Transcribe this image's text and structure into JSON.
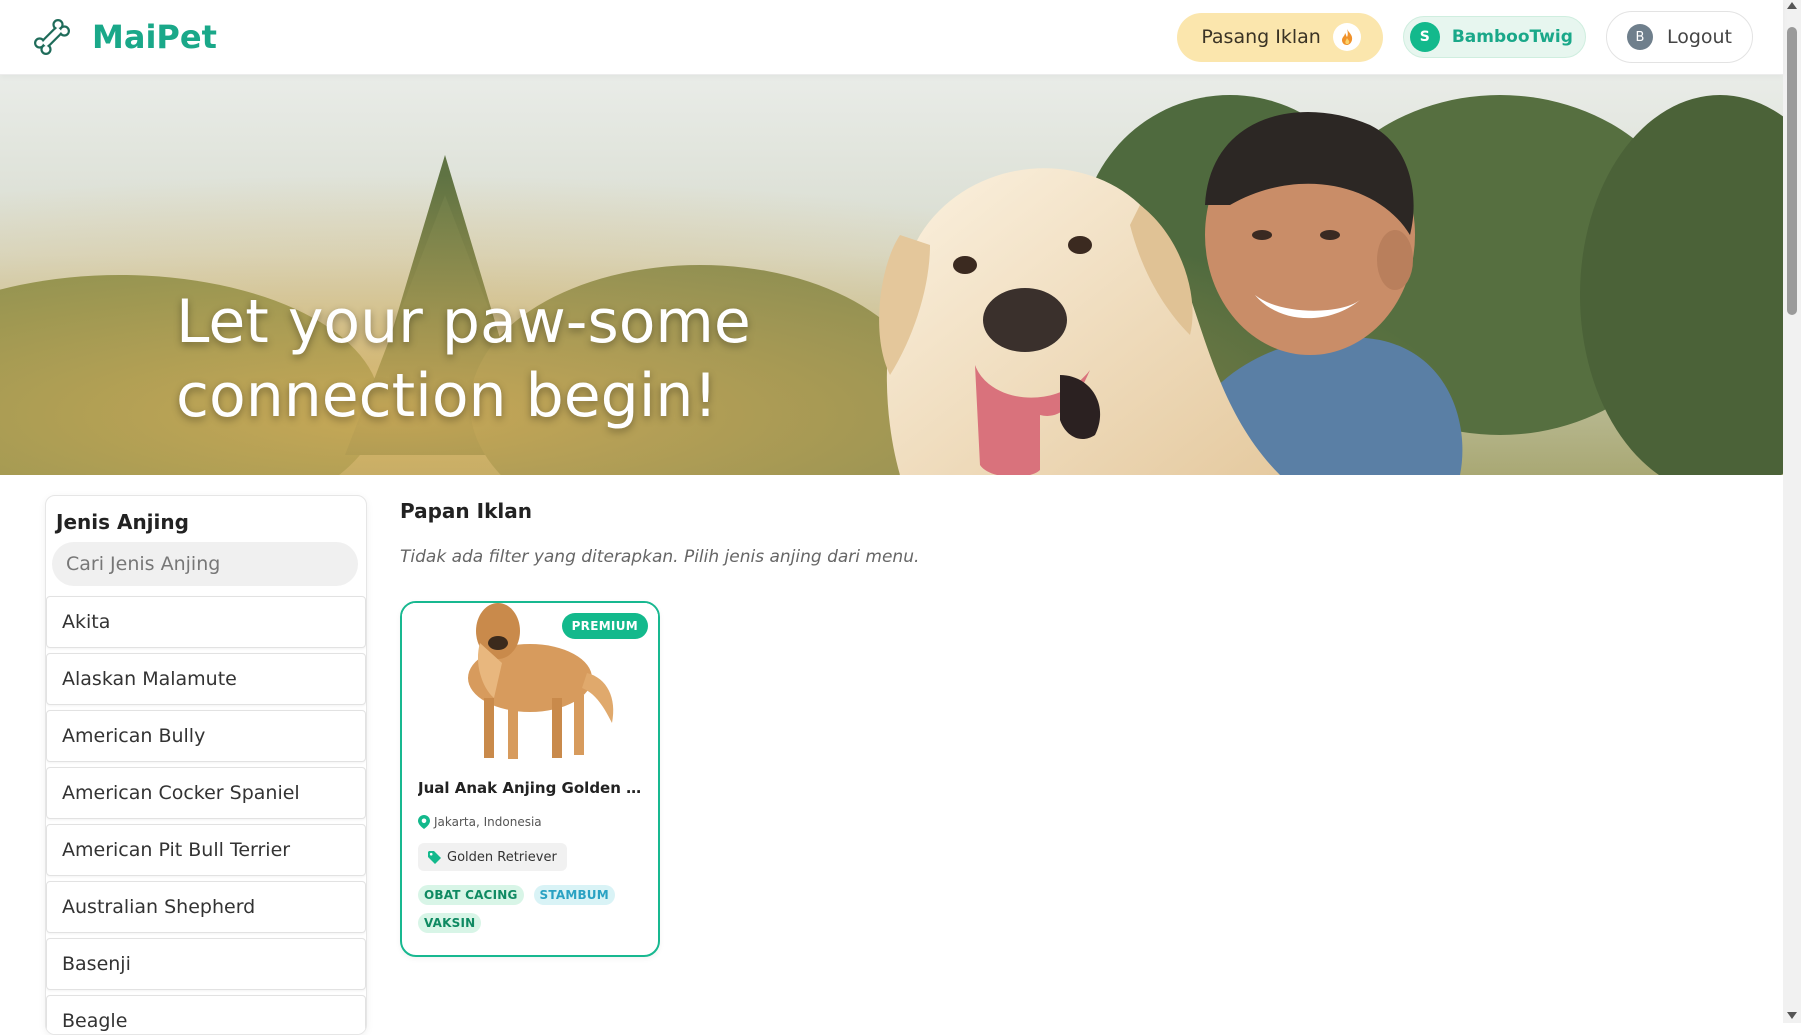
{
  "header": {
    "brand_name": "MaiPet",
    "brand_icon": "bone-icon",
    "post_ad_label": "Pasang Iklan",
    "post_ad_icon": "flame-icon",
    "user_initial": "S",
    "username": "BambooTwig",
    "logout_initial": "B",
    "logout_label": "Logout"
  },
  "hero": {
    "headline": "Let your paw-some\nconnection begin!"
  },
  "sidebar": {
    "title": "Jenis Anjing",
    "search_placeholder": "Cari Jenis Anjing",
    "items": [
      "Akita",
      "Alaskan Malamute",
      "American Bully",
      "American Cocker Spaniel",
      "American Pit Bull Terrier",
      "Australian Shepherd",
      "Basenji",
      "Beagle"
    ]
  },
  "main": {
    "title": "Papan Iklan",
    "no_filter_text": "Tidak ada filter yang diterapkan. Pilih jenis anjing dari menu.",
    "listings": [
      {
        "badge": "PREMIUM",
        "title": "Jual Anak Anjing Golden Retr...",
        "location": "Jakarta, Indonesia",
        "breed": "Golden Retriever",
        "tags": [
          "OBAT CACING",
          "STAMBUM",
          "VAKSIN"
        ]
      }
    ]
  },
  "colors": {
    "brand": "#1aa889",
    "accent": "#13b98c",
    "post_ad_bg": "#fbe6ad"
  }
}
